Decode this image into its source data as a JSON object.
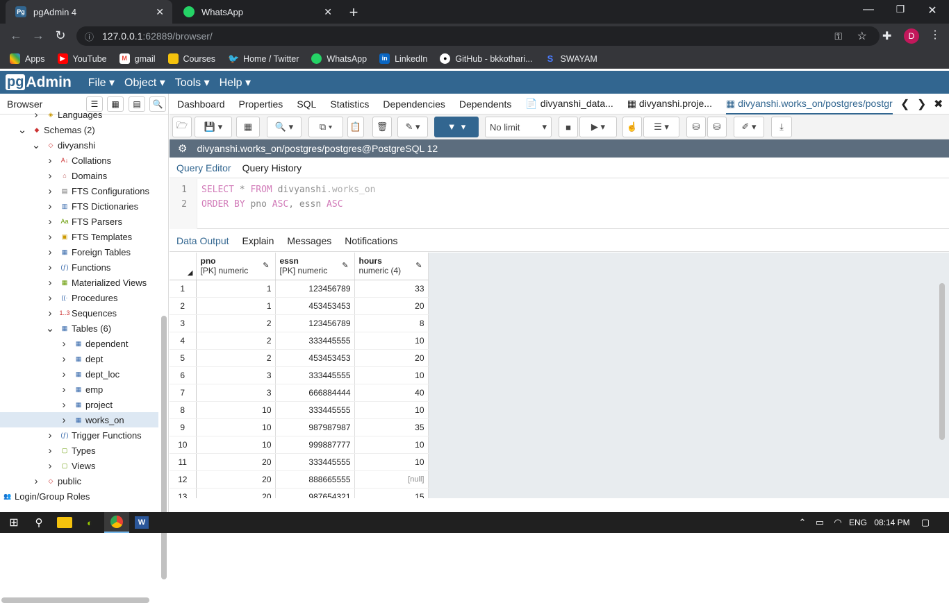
{
  "browser": {
    "tabs": [
      {
        "title": "pgAdmin 4",
        "fav_text": "Pg"
      },
      {
        "title": "WhatsApp",
        "fav_text": ""
      }
    ],
    "url_host": "127.0.0.1",
    "url_port": ":62889/browser/",
    "profile_initial": "D",
    "bookmarks": [
      "Apps",
      "YouTube",
      "gmail",
      "Courses",
      "Home / Twitter",
      "WhatsApp",
      "LinkedIn",
      "GitHub - bkkothari...",
      "SWAYAM"
    ]
  },
  "pgadmin": {
    "logo_pg": "pg",
    "logo_rest": "Admin",
    "menu": [
      "File",
      "Object",
      "Tools",
      "Help"
    ]
  },
  "left_panel": {
    "title": "Browser",
    "tree": [
      {
        "label": "Languages",
        "level": 2,
        "icon": "language-icon"
      },
      {
        "label": "Schemas (2)",
        "level": 1,
        "icon": "schemas-icon"
      },
      {
        "label": "divyanshi",
        "level": 2,
        "icon": "schema-icon"
      },
      {
        "label": "Collations",
        "level": 3,
        "icon": "collations-icon"
      },
      {
        "label": "Domains",
        "level": 3,
        "icon": "domains-icon"
      },
      {
        "label": "FTS Configurations",
        "level": 3,
        "icon": "fts-configurations-icon"
      },
      {
        "label": "FTS Dictionaries",
        "level": 3,
        "icon": "fts-dictionaries-icon"
      },
      {
        "label": "FTS Parsers",
        "level": 3,
        "icon": "fts-parsers-icon"
      },
      {
        "label": "FTS Templates",
        "level": 3,
        "icon": "fts-templates-icon"
      },
      {
        "label": "Foreign Tables",
        "level": 3,
        "icon": "foreign-tables-icon"
      },
      {
        "label": "Functions",
        "level": 3,
        "icon": "functions-icon"
      },
      {
        "label": "Materialized Views",
        "level": 3,
        "icon": "materialized-views-icon"
      },
      {
        "label": "Procedures",
        "level": 3,
        "icon": "procedures-icon"
      },
      {
        "label": "Sequences",
        "level": 3,
        "icon": "sequences-icon"
      },
      {
        "label": "Tables (6)",
        "level": 3,
        "icon": "tables-icon"
      },
      {
        "label": "dependent",
        "level": 4,
        "icon": "table-icon"
      },
      {
        "label": "dept",
        "level": 4,
        "icon": "table-icon"
      },
      {
        "label": "dept_loc",
        "level": 4,
        "icon": "table-icon"
      },
      {
        "label": "emp",
        "level": 4,
        "icon": "table-icon"
      },
      {
        "label": "project",
        "level": 4,
        "icon": "table-icon"
      },
      {
        "label": "works_on",
        "level": 4,
        "icon": "table-icon"
      },
      {
        "label": "Trigger Functions",
        "level": 3,
        "icon": "trigger-functions-icon"
      },
      {
        "label": "Types",
        "level": 3,
        "icon": "types-icon"
      },
      {
        "label": "Views",
        "level": 3,
        "icon": "views-icon"
      },
      {
        "label": "public",
        "level": 2,
        "icon": "schema-icon"
      },
      {
        "label": "Login/Group Roles",
        "level": 0,
        "icon": "login-roles-icon"
      }
    ]
  },
  "main_tabs": [
    "Dashboard",
    "Properties",
    "SQL",
    "Statistics",
    "Dependencies",
    "Dependents",
    "divyanshi_data...",
    "divyanshi.proje...",
    "divyanshi.works_on/postgres/postgr"
  ],
  "toolbar": {
    "limit_label": "No limit"
  },
  "connection_label": "divyanshi.works_on/postgres/postgres@PostgreSQL 12",
  "query_tabs": [
    "Query Editor",
    "Query History"
  ],
  "editor": {
    "line1": {
      "n": "1",
      "kw1": "SELECT",
      "star": " * ",
      "kw2": "FROM",
      "schema": " divyanshi",
      "table": ".works_on"
    },
    "line2": {
      "n": "2",
      "kw1": "ORDER BY",
      "c1": " pno ",
      "kw2": "ASC",
      "c2": ", essn ",
      "kw3": "ASC"
    }
  },
  "output_tabs": [
    "Data Output",
    "Explain",
    "Messages",
    "Notifications"
  ],
  "grid": {
    "columns": [
      {
        "name": "pno",
        "type": "[PK] numeric"
      },
      {
        "name": "essn",
        "type": "[PK] numeric"
      },
      {
        "name": "hours",
        "type": "numeric (4)"
      }
    ],
    "rows": [
      [
        "1",
        "1",
        "123456789",
        "33"
      ],
      [
        "2",
        "1",
        "453453453",
        "20"
      ],
      [
        "3",
        "2",
        "123456789",
        "8"
      ],
      [
        "4",
        "2",
        "333445555",
        "10"
      ],
      [
        "5",
        "2",
        "453453453",
        "20"
      ],
      [
        "6",
        "3",
        "333445555",
        "10"
      ],
      [
        "7",
        "3",
        "666884444",
        "40"
      ],
      [
        "8",
        "10",
        "333445555",
        "10"
      ],
      [
        "9",
        "10",
        "987987987",
        "35"
      ],
      [
        "10",
        "10",
        "999887777",
        "10"
      ],
      [
        "11",
        "20",
        "333445555",
        "10"
      ],
      [
        "12",
        "20",
        "888665555",
        "[null]"
      ],
      [
        "13",
        "20",
        "987654321",
        "15"
      ]
    ]
  },
  "taskbar": {
    "lang": "ENG",
    "time": "08:14 PM"
  }
}
